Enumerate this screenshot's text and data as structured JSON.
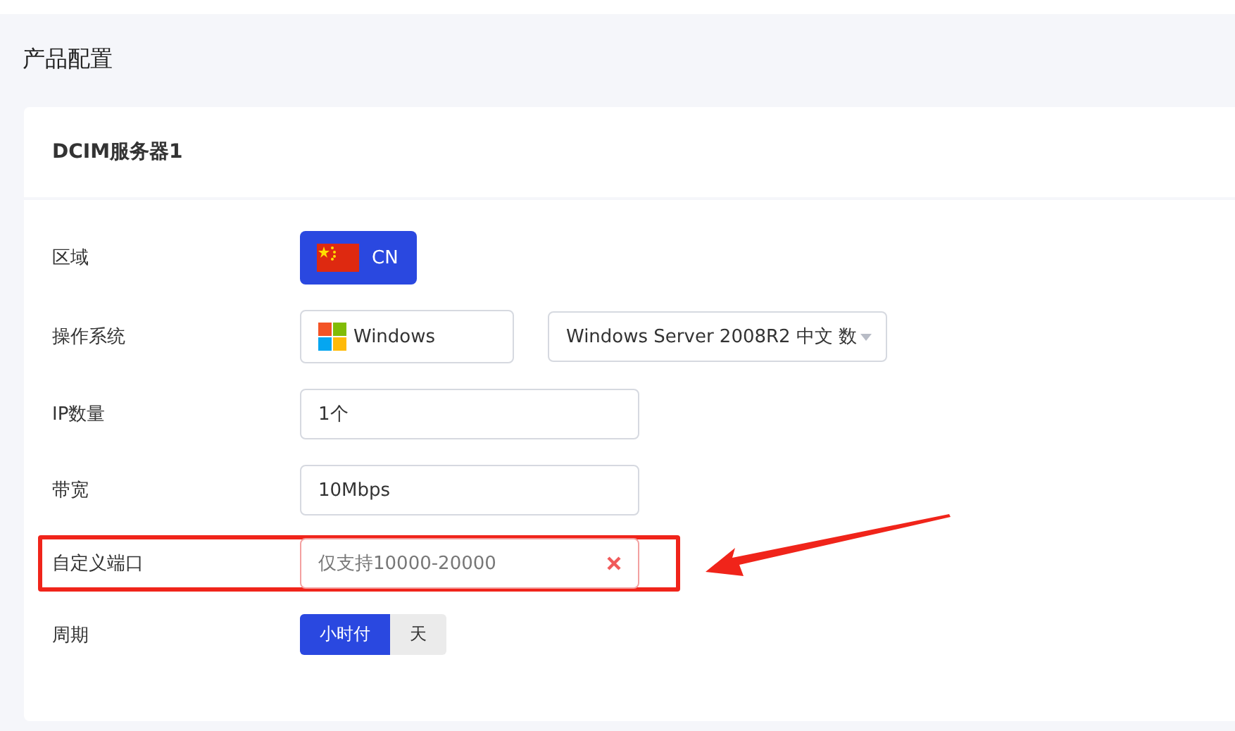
{
  "section_title": "产品配置",
  "card": {
    "title": "DCIM服务器1",
    "rows": [
      {
        "kind": "region",
        "label": "区域",
        "highlighted": false,
        "options": [
          {
            "label": "CN",
            "selected": true
          }
        ]
      },
      {
        "kind": "os",
        "label": "操作系统",
        "highlighted": false,
        "os_family": "Windows",
        "os_version": "Windows Server 2008R2 中文 数"
      },
      {
        "kind": "field",
        "label": "IP数量",
        "highlighted": false,
        "value": "1个"
      },
      {
        "kind": "field",
        "label": "带宽",
        "highlighted": false,
        "value": "10Mbps"
      },
      {
        "kind": "field",
        "label": "自定义端口",
        "highlighted": true,
        "placeholder": "仅支持10000-20000",
        "invalid": true
      },
      {
        "kind": "toggle",
        "label": "周期",
        "highlighted": false,
        "options": [
          {
            "label": "小时付",
            "selected": true
          },
          {
            "label": "天",
            "selected": false
          }
        ]
      }
    ]
  }
}
